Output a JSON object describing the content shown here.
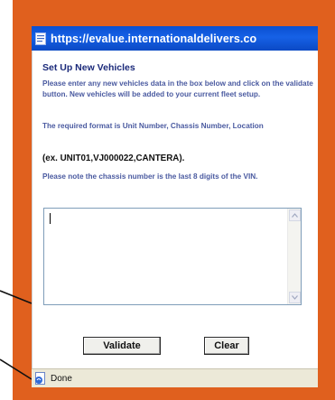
{
  "window": {
    "title": "https://evalue.internationaldelivers.co"
  },
  "form": {
    "heading": "Set Up New Vehicles",
    "instructions": "Please enter any new vehicles data in the box below and click on the validate button. New vehicles will be added to your current fleet setup.",
    "format_note": "The required format is Unit Number, Chassis Number, Location",
    "example": "(ex. UNIT01,VJ000022,CANTERA).",
    "chassis_note": "Please note the chassis number is the last 8 digits of the VIN.",
    "vehicle_data_value": ""
  },
  "buttons": {
    "validate_label": "Validate",
    "clear_label": "Clear"
  },
  "status": {
    "text": "Done"
  },
  "colors": {
    "accent_frame": "#e0601e",
    "titlebar": "#0a4fd0",
    "heading": "#1b2a7a",
    "body_text": "#4a5aa0"
  },
  "icons": {
    "title": "ie-page-icon",
    "status": "ie-page-icon"
  }
}
